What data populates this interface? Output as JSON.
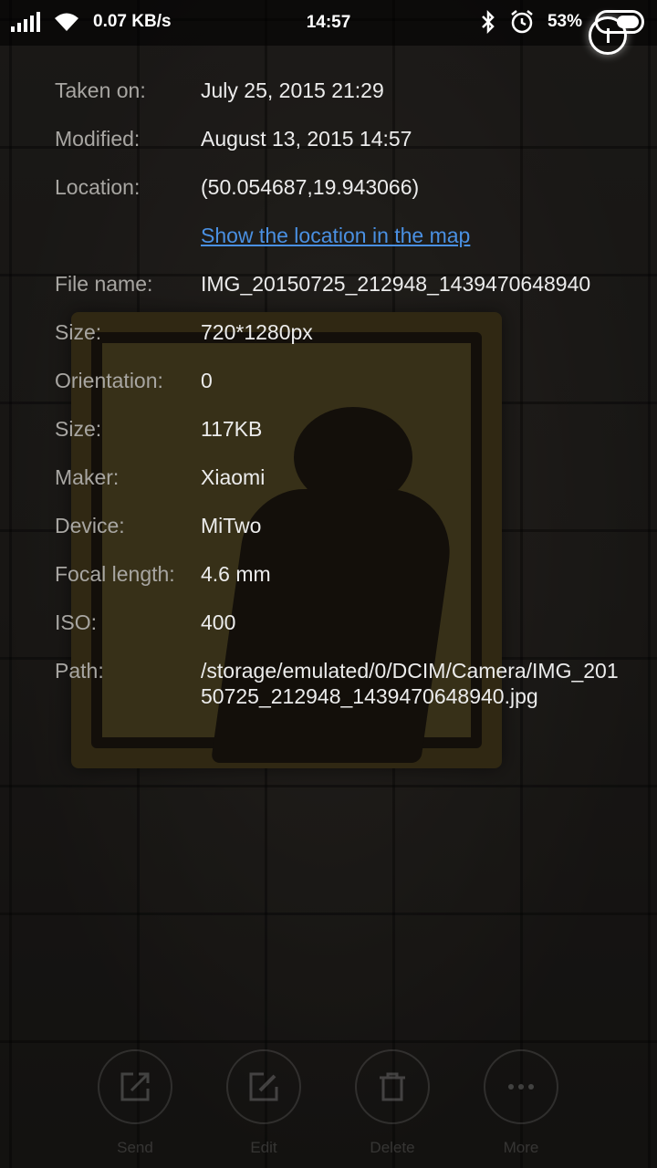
{
  "status_bar": {
    "network_speed": "0.07 KB/s",
    "time": "14:57",
    "battery_percent": "53%"
  },
  "details": [
    {
      "label": "Taken on:",
      "value": "July 25, 2015 21:29"
    },
    {
      "label": "Modified:",
      "value": "August 13, 2015 14:57"
    },
    {
      "label": "Location:",
      "value": "(50.054687,19.943066)"
    },
    {
      "label": "",
      "value": "Show the location in the map"
    },
    {
      "label": "File name:",
      "value": "IMG_20150725_212948_1439470648940"
    },
    {
      "label": "Size:",
      "value": "720*1280px"
    },
    {
      "label": "Orientation:",
      "value": "0"
    },
    {
      "label": "Size:",
      "value": "117KB"
    },
    {
      "label": "Maker:",
      "value": "Xiaomi"
    },
    {
      "label": "Device:",
      "value": "MiTwo"
    },
    {
      "label": "Focal length:",
      "value": "4.6 mm"
    },
    {
      "label": "ISO:",
      "value": "400"
    },
    {
      "label": "Path:",
      "value": "/storage/emulated/0/DCIM/Camera/IMG_20150725_212948_1439470648940.jpg"
    }
  ],
  "actions": [
    {
      "label": "Send",
      "icon": "share-icon"
    },
    {
      "label": "Edit",
      "icon": "edit-icon"
    },
    {
      "label": "Delete",
      "icon": "trash-icon"
    },
    {
      "label": "More",
      "icon": "more-dots-icon"
    }
  ]
}
